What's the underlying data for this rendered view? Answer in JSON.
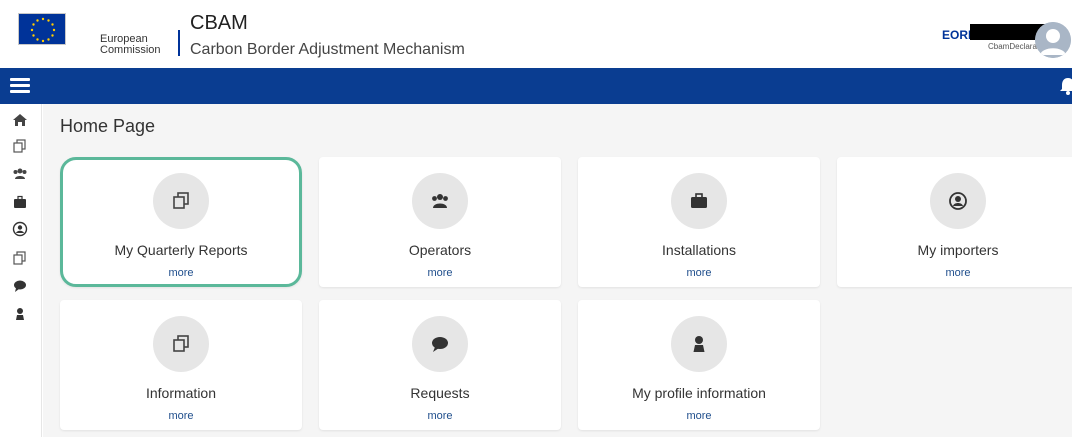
{
  "header": {
    "org_line1": "European",
    "org_line2": "Commission",
    "app_name": "CBAM",
    "app_subtitle": "Carbon Border Adjustment Mechanism"
  },
  "user": {
    "eori_label": "EORI",
    "role": "CbamDeclarant"
  },
  "page": {
    "title": "Home Page"
  },
  "cards": [
    {
      "label": "My Quarterly Reports",
      "more": "more",
      "icon": "reports-icon"
    },
    {
      "label": "Operators",
      "more": "more",
      "icon": "users-group-icon"
    },
    {
      "label": "Installations",
      "more": "more",
      "icon": "briefcase-icon"
    },
    {
      "label": "My importers",
      "more": "more",
      "icon": "user-circle-icon"
    },
    {
      "label": "Information",
      "more": "more",
      "icon": "copy-icon"
    },
    {
      "label": "Requests",
      "more": "more",
      "icon": "chat-bubble-icon"
    },
    {
      "label": "My profile information",
      "more": "more",
      "icon": "person-icon"
    }
  ],
  "colors": {
    "navbar": "#0a3d91",
    "highlight": "#5bb89a",
    "link": "#1f4e8c"
  }
}
